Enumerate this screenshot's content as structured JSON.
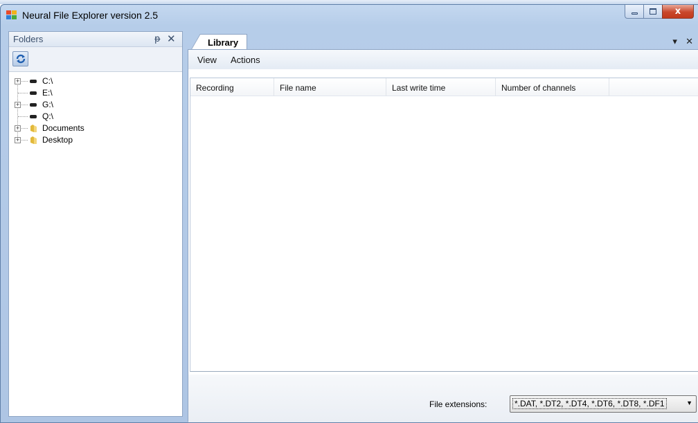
{
  "window": {
    "title": "Neural File Explorer version 2.5",
    "close_glyph": "x"
  },
  "folders_pane": {
    "title": "Folders",
    "pin_glyph": "ᵽ",
    "close_glyph": "✕",
    "tree": [
      {
        "label": "C:\\",
        "kind": "drive",
        "expandable": true
      },
      {
        "label": "E:\\",
        "kind": "drive",
        "expandable": false
      },
      {
        "label": "G:\\",
        "kind": "drive",
        "expandable": true
      },
      {
        "label": "Q:\\",
        "kind": "drive",
        "expandable": false
      },
      {
        "label": "Documents",
        "kind": "folder",
        "expandable": true
      },
      {
        "label": "Desktop",
        "kind": "folder",
        "expandable": true
      }
    ]
  },
  "library": {
    "tab_label": "Library",
    "tab_dropdown_glyph": "▾",
    "tab_close_glyph": "✕",
    "menu": [
      "View",
      "Actions"
    ],
    "columns": [
      "Recording",
      "File name",
      "Last write time",
      "Number of channels"
    ],
    "status": {
      "extensions_label": "File extensions:",
      "extensions_value": "*.DAT, *.DT2, *.DT4, *.DT6, *.DT8, *.DF1"
    }
  },
  "colors": {
    "window_frame": "#b6cde9",
    "close_button": "#c9472b",
    "folder_icon": "#e2b93b"
  }
}
